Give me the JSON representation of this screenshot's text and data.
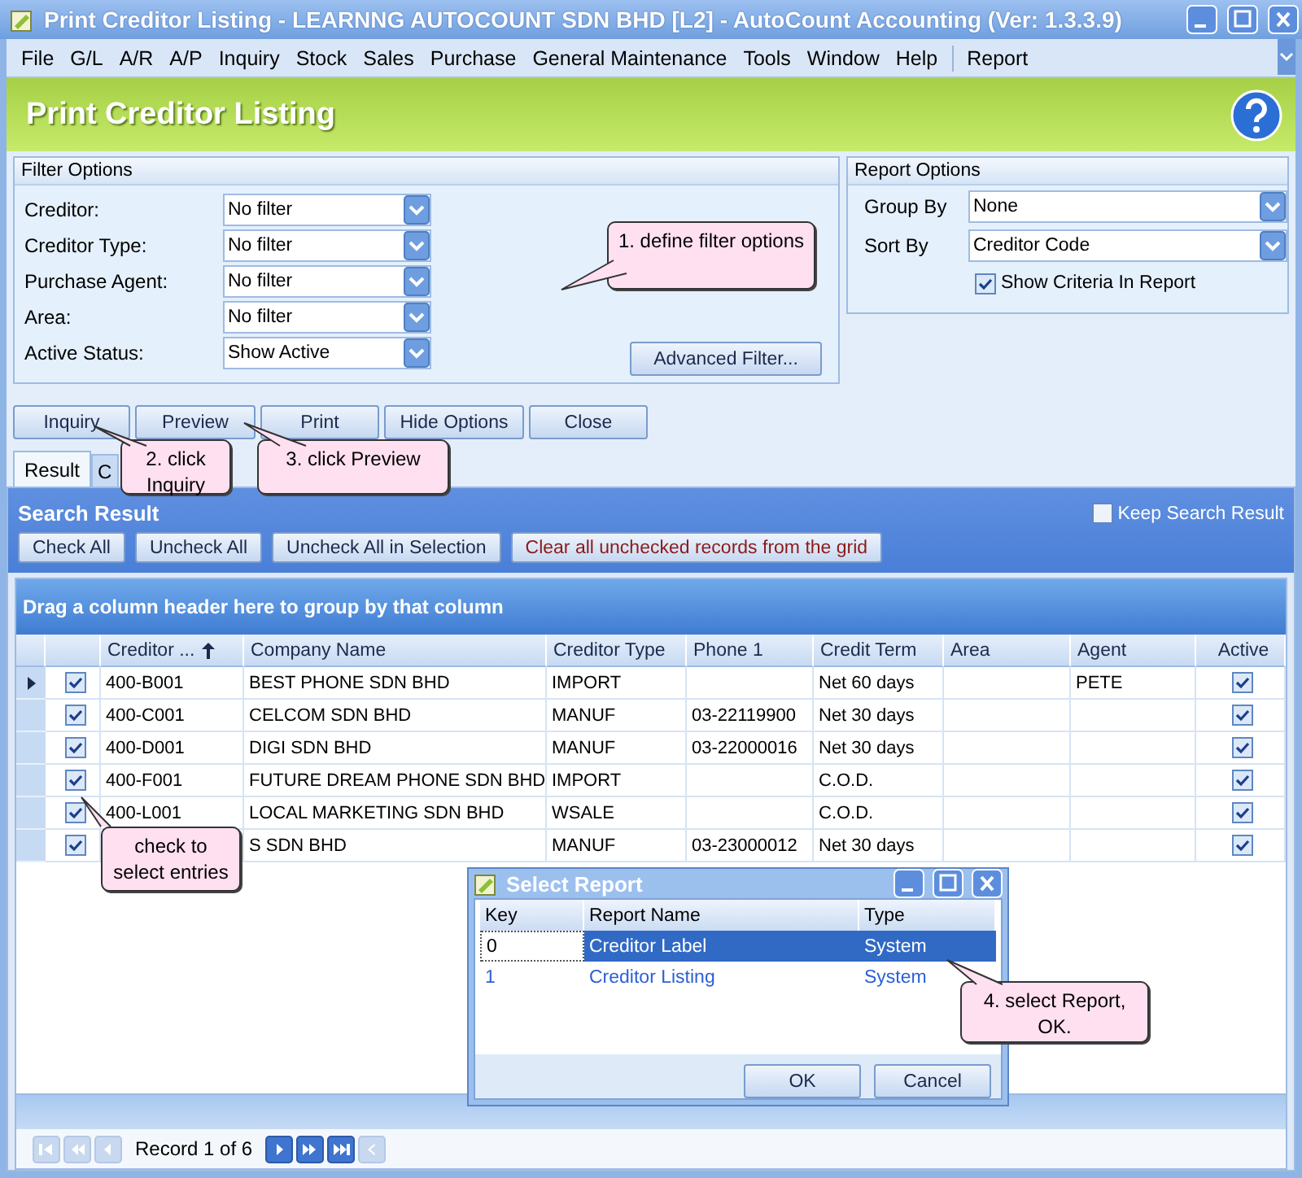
{
  "window": {
    "title": "Print Creditor Listing - LEARNNG AUTOCOUNT SDN BHD [L2] - AutoCount Accounting (Ver: 1.3.3.9)"
  },
  "menu": [
    {
      "label": "File"
    },
    {
      "label": "G/L"
    },
    {
      "label": "A/R"
    },
    {
      "label": "A/P"
    },
    {
      "label": "Inquiry"
    },
    {
      "label": "Stock"
    },
    {
      "label": "Sales"
    },
    {
      "label": "Purchase"
    },
    {
      "label": "General Maintenance"
    },
    {
      "label": "Tools"
    },
    {
      "label": "Window"
    },
    {
      "label": "Help"
    },
    {
      "label": "Report"
    }
  ],
  "header": {
    "title": "Print Creditor Listing"
  },
  "filter_options": {
    "title": "Filter Options",
    "fields": [
      {
        "label": "Creditor:",
        "value": "No filter"
      },
      {
        "label": "Creditor Type:",
        "value": "No filter"
      },
      {
        "label": "Purchase Agent:",
        "value": "No filter"
      },
      {
        "label": "Area:",
        "value": "No filter"
      },
      {
        "label": "Active Status:",
        "value": "Show Active"
      }
    ],
    "advanced_button": "Advanced Filter..."
  },
  "report_options": {
    "title": "Report Options",
    "fields": [
      {
        "label": "Group By",
        "value": "None"
      },
      {
        "label": "Sort By",
        "value": "Creditor Code"
      }
    ],
    "show_criteria": {
      "label": "Show Criteria In Report",
      "checked": true
    }
  },
  "actions": [
    "Inquiry",
    "Preview",
    "Print",
    "Hide Options",
    "Close"
  ],
  "tabs": [
    {
      "label": "Result",
      "selected": true
    },
    {
      "label": "C",
      "selected": false
    }
  ],
  "search_result": {
    "title": "Search Result",
    "keep": {
      "label": "Keep Search Result",
      "checked": false
    },
    "buttons": [
      {
        "label": "Check All",
        "kind": "normal"
      },
      {
        "label": "Uncheck All",
        "kind": "normal"
      },
      {
        "label": "Uncheck All in Selection",
        "kind": "normal"
      },
      {
        "label": "Clear all unchecked records from the grid",
        "kind": "warning"
      }
    ]
  },
  "grid": {
    "group_hint": "Drag a column header here to group by that column",
    "columns": [
      {
        "label": "Creditor ...",
        "sorted": true
      },
      {
        "label": "Company Name",
        "sorted": false
      },
      {
        "label": "Creditor Type",
        "sorted": false
      },
      {
        "label": "Phone 1",
        "sorted": false
      },
      {
        "label": "Credit Term",
        "sorted": false
      },
      {
        "label": "Area",
        "sorted": false
      },
      {
        "label": "Agent",
        "sorted": false
      },
      {
        "label": "Active",
        "sorted": false
      }
    ],
    "rows": [
      {
        "selected": true,
        "checked": true,
        "code": "400-B001",
        "company": "BEST PHONE SDN BHD",
        "type": "IMPORT",
        "term": "Net 60 days",
        "agent": "PETE",
        "active": true
      },
      {
        "selected": false,
        "checked": true,
        "code": "400-C001",
        "company": "CELCOM SDN BHD",
        "type": "MANUF",
        "phone": "03-22119900",
        "term": "Net 30 days",
        "active": true
      },
      {
        "selected": false,
        "checked": true,
        "code": "400-D001",
        "company": "DIGI SDN BHD",
        "type": "MANUF",
        "phone": "03-22000016",
        "term": "Net 30 days",
        "active": true
      },
      {
        "selected": false,
        "checked": true,
        "code": "400-F001",
        "company": "FUTURE DREAM PHONE SDN BHD",
        "type": "IMPORT",
        "term": "C.O.D.",
        "active": true
      },
      {
        "selected": false,
        "checked": true,
        "code": "400-L001",
        "company": "LOCAL MARKETING SDN BHD",
        "type": "WSALE",
        "term": "C.O.D.",
        "active": true
      },
      {
        "selected": false,
        "checked": true,
        "company": "S SDN BHD",
        "type": "MANUF",
        "phone": "03-23000012",
        "term": "Net 30 days",
        "active": true
      }
    ]
  },
  "navigator": {
    "record": "Record 1 of 6"
  },
  "dialog": {
    "title": "Select Report",
    "columns": [
      "Key",
      "Report Name",
      "Type"
    ],
    "rows": [
      {
        "key": "0",
        "name": "Creditor Label",
        "type": "System",
        "selected": true
      },
      {
        "key": "1",
        "name": "Creditor Listing",
        "type": "System",
        "selected": false
      }
    ],
    "buttons": [
      "OK",
      "Cancel"
    ]
  },
  "callouts": [
    {
      "text": "1. define filter options"
    },
    {
      "text": "2. click Inquiry"
    },
    {
      "text": "3. click Preview"
    },
    {
      "text": "check to select entries"
    },
    {
      "text": "4. select Report, OK."
    }
  ]
}
